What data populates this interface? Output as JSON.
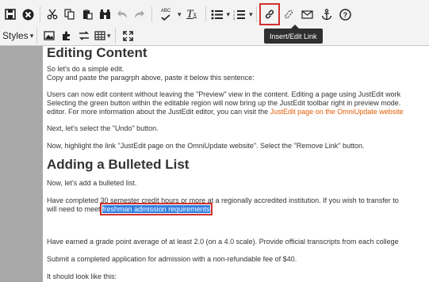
{
  "toolbar": {
    "row1": {
      "save_icon": "save-icon",
      "close_icon": "close-icon",
      "cut_icon": "scissors-icon",
      "copy_icon": "copy-icon",
      "paste_icon": "paste-icon",
      "find_icon": "binoculars-icon",
      "undo_icon": "undo-icon",
      "redo_icon": "redo-icon",
      "spellcheck_label": "ABC",
      "clear_format_label": "T",
      "bullets_icon": "bullet-list-icon",
      "numbered_icon": "numbered-list-icon",
      "link_icon": "link-icon",
      "unlink_icon": "unlink-icon",
      "email_icon": "mail-icon",
      "anchor_icon": "anchor-icon",
      "help_icon": "help-icon"
    },
    "row2": {
      "styles_label": "Styles",
      "image_icon": "image-icon",
      "puzzle_icon": "puzzle-icon",
      "swap_icon": "swap-icon",
      "table_icon": "table-icon",
      "fullscreen_icon": "fullscreen-icon"
    },
    "tooltip": "Insert/Edit Link"
  },
  "content": {
    "heading1": "Editing Content",
    "p1_line1": "So let's do a simple edit.",
    "p1_line2": "Copy and paste the paragrph above, paste it below this sentence:",
    "p2_line1": "Users can now edit content without leaving the \"Preview\" view in the content. Editing a page using JustEdit work",
    "p2_line2": "Selecting the green button within the editable region will now bring up the JustEdit toolbar right in preview mode.",
    "p2_line3_prefix": "editor. For more information about the JustEdit editor, you can visit the ",
    "p2_link": "JustEdit page on the OmniUpdate website",
    "p3": "Next, let's select the \"Undo\" button.",
    "p4": "Now, highlight the link \"JustEdit page on the OmniUpdate website\". Select the \"Remove Link\" button.",
    "heading2": "Adding a Bulleted List",
    "p5": "Now, let's add a bulleted list.",
    "p6_line1": "Have completed 30 semester credit hours or more at a regionally accredited institution. If you wish to transfer to",
    "p6_line2_prefix": "will need to meet ",
    "p6_selected": "freshman admission requirements",
    "p6_line2_suffix": ".",
    "p7": "Have earned a grade point average of at least 2.0 (on a 4.0 scale). Provide official transcripts from each college",
    "p8": "Submit a completed application for admission with a non-refundable fee of $40.",
    "p9": "It should look like this:"
  }
}
